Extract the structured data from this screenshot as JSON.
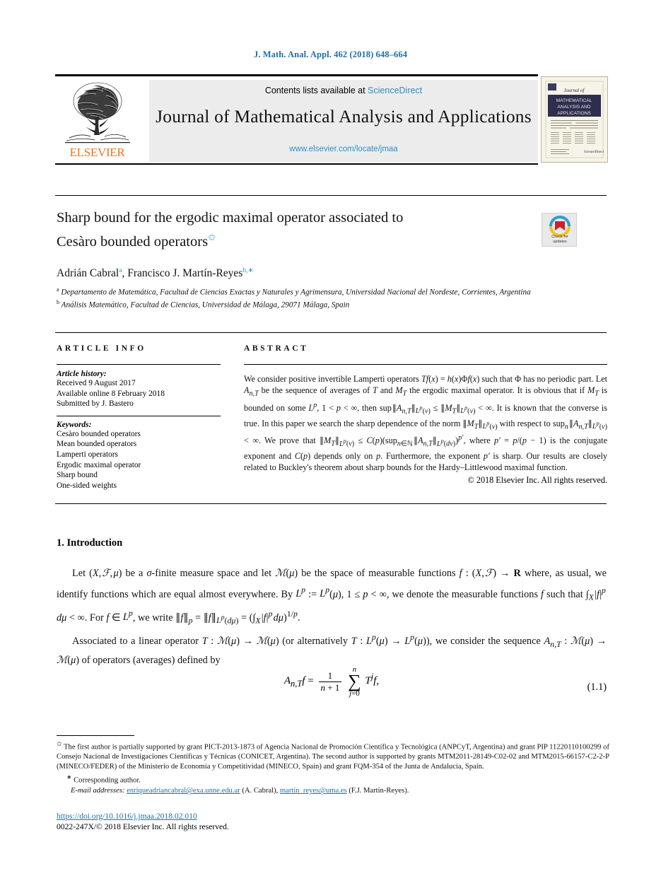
{
  "running_head": "J. Math. Anal. Appl. 462 (2018) 648–664",
  "masthead": {
    "contents_prefix": "Contents lists available at ",
    "contents_link": "ScienceDirect",
    "journal_title": "Journal of Mathematical Analysis and Applications",
    "journal_url": "www.elsevier.com/locate/jmaa",
    "publisher_wordmark": "ELSEVIER",
    "cover_line1": "Journal of",
    "cover_line2": "MATHEMATICAL",
    "cover_line3": "ANALYSIS AND",
    "cover_line4": "APPLICATIONS"
  },
  "article": {
    "title_line1": "Sharp bound for the ergodic maximal operator associated to",
    "title_line2": "Cesàro bounded operators",
    "title_footnote_mark": "✩",
    "authors": "Adrián Cabral",
    "author_mark_a": "a",
    "authors_sep": ", ",
    "author2": "Francisco J. Martín-Reyes",
    "author_mark_b": "b,∗",
    "affiliation_a_mark": "a",
    "affiliation_a": "Departamento de Matemática, Facultad de Ciencias Exactas y Naturales y Agrimensura, Universidad Nacional del Nordeste, Corrientes, Argentina",
    "affiliation_b_mark": "b",
    "affiliation_b": "Análisis Matemático, Facultad de Ciencias, Universidad de Málaga, 29071 Málaga, Spain"
  },
  "crossmark": {
    "line1": "Check for",
    "line2": "updates"
  },
  "article_info": {
    "heading": "ARTICLE INFO",
    "history_label": "Article history:",
    "history": [
      "Received 9 August 2017",
      "Available online 8 February 2018",
      "Submitted by J. Bastero"
    ],
    "keywords_label": "Keywords:",
    "keywords": [
      "Cesàro bounded operators",
      "Mean bounded operators",
      "Lamperti operators",
      "Ergodic maximal operator",
      "Sharp bound",
      "One-sided weights"
    ]
  },
  "abstract": {
    "heading": "ABSTRACT",
    "copyright": "© 2018 Elsevier Inc. All rights reserved."
  },
  "introduction": {
    "heading": "1. Introduction",
    "equation_number": "(1.1)"
  },
  "footnotes": {
    "funding_mark": "✩",
    "funding": "The first author is partially supported by grant PICT-2013-1873 of Agencia Nacional de Promoción Científica y Tecnológica (ANPCyT, Argentina) and grant PIP 11220110100299 of Consejo Nacional de Investigaciones Científicas y Técnicas (CONICET, Argentina). The second author is supported by grants MTM2011-28149-C02-02 and MTM2015-66157-C2-2-P (MINECO/FEDER) of the Ministerio de Economía y Competitividad (MINECO, Spain) and grant FQM-354 of the Junta de Andalucía, Spain.",
    "corresponding_mark": "∗",
    "corresponding": "Corresponding author.",
    "email_label": "E-mail addresses:",
    "email1": "enriqueadriancabral@exa.unne.edu.ar",
    "email1_attrib": "(A. Cabral),",
    "email2": "martin_reyes@uma.es",
    "email2_attrib": "(F.J. Martín-Reyes)."
  },
  "bottom": {
    "doi": "https://doi.org/10.1016/j.jmaa.2018.02.010",
    "issn": "0022-247X/© 2018 Elsevier Inc. All rights reserved."
  },
  "colors": {
    "link": "#1f6fa8",
    "sciencedirect": "#2f8fc4",
    "elsevier_orange": "#e87722",
    "masthead_bg": "#ececec"
  }
}
